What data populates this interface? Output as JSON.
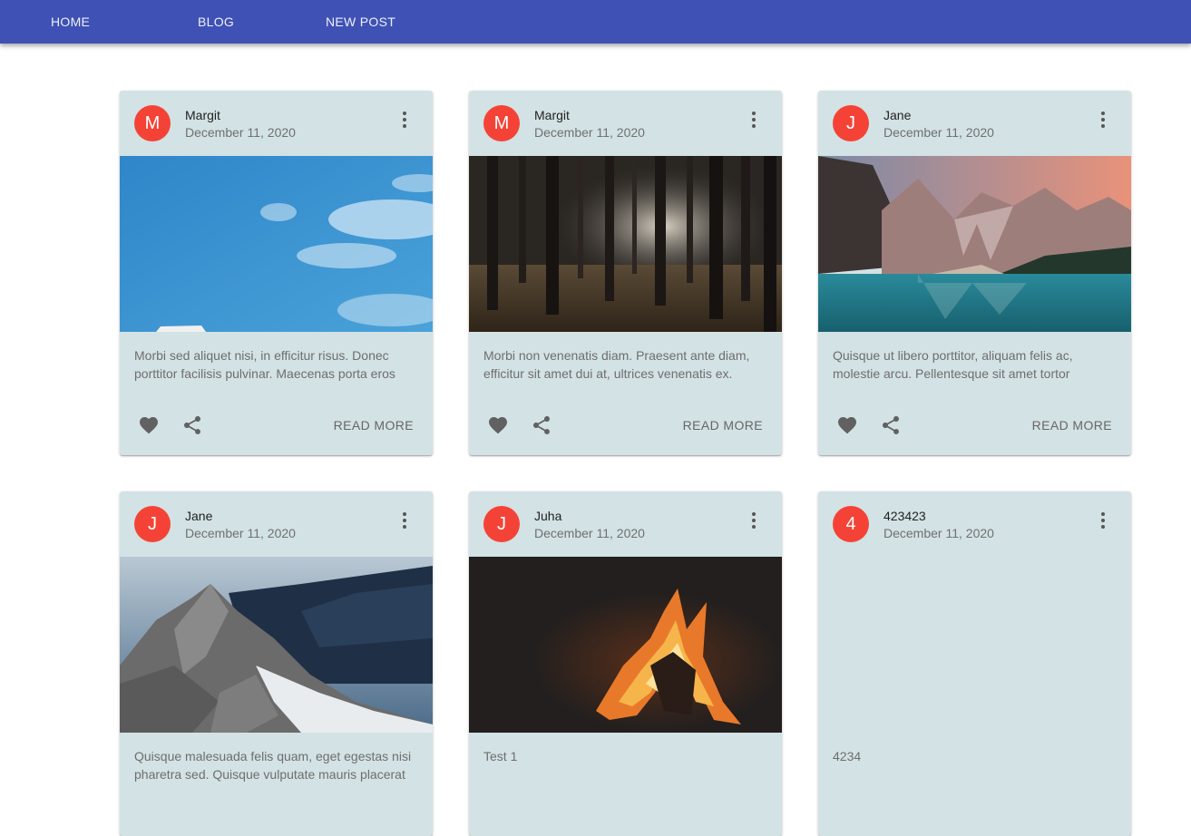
{
  "nav": {
    "home": "HOME",
    "blog": "BLOG",
    "new_post": "NEW POST"
  },
  "colors": {
    "appbar": "#3f51b5",
    "card": "#d3e2e4",
    "avatar": "#f44336"
  },
  "posts": [
    {
      "initial": "M",
      "author": "Margit",
      "date": "December 11, 2020",
      "image": "sky-with-clouds",
      "excerpt": "Morbi sed aliquet nisi, in efficitur risus. Donec porttitor facilisis pulvinar. Maecenas porta eros",
      "read_more": "READ MORE"
    },
    {
      "initial": "M",
      "author": "Margit",
      "date": "December 11, 2020",
      "image": "dark-forest",
      "excerpt": "Morbi non venenatis diam. Praesent ante diam, efficitur sit amet dui at, ultrices venenatis ex.",
      "read_more": "READ MORE"
    },
    {
      "initial": "J",
      "author": "Jane",
      "date": "December 11, 2020",
      "image": "mountain-lake",
      "excerpt": "Quisque ut libero porttitor, aliquam felis ac, molestie arcu. Pellentesque sit amet tortor",
      "read_more": "READ MORE"
    },
    {
      "initial": "J",
      "author": "Jane",
      "date": "December 11, 2020",
      "image": "snowy-rocky-peak",
      "excerpt": "Quisque malesuada felis quam, eget egestas nisi pharetra sed. Quisque vulputate mauris placerat",
      "read_more": ""
    },
    {
      "initial": "J",
      "author": "Juha",
      "date": "December 11, 2020",
      "image": "campfire",
      "excerpt": "Test 1",
      "read_more": ""
    },
    {
      "initial": "4",
      "author": "423423",
      "date": "December 11, 2020",
      "image": "",
      "excerpt": "4234",
      "read_more": ""
    }
  ]
}
